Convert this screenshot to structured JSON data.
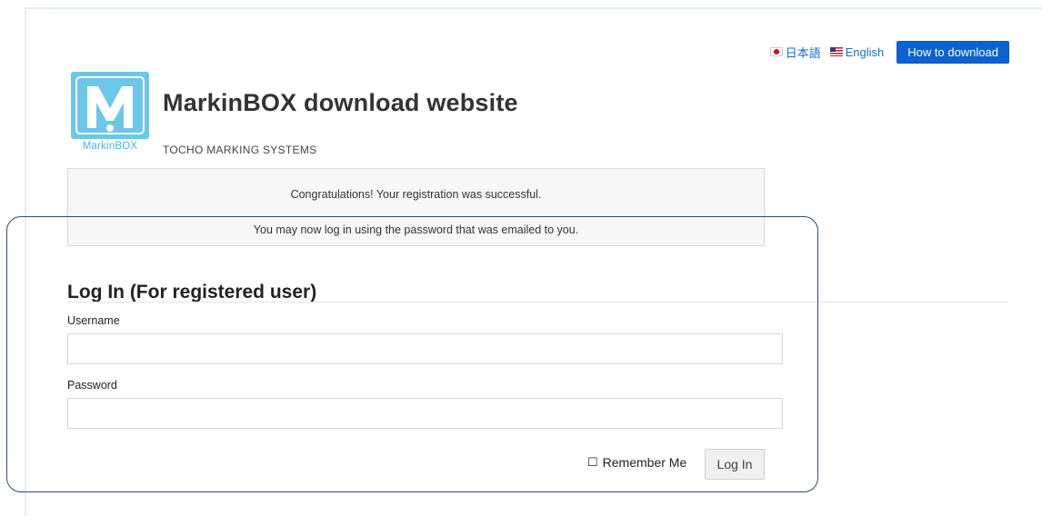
{
  "header": {
    "languages": [
      {
        "label": "日本語",
        "flag_icon": "japan-flag-icon"
      },
      {
        "label": "English",
        "flag_icon": "us-flag-icon"
      }
    ],
    "how_to_download_label": "How to download"
  },
  "brand": {
    "logo_text": "MarkinBOX",
    "title": "MarkinBOX download website",
    "subtitle": "TOCHO MARKING SYSTEMS",
    "logo_color": "#6cc7e6"
  },
  "notice": {
    "line1": "Congratulations! Your registration was successful.",
    "line2": "You may now log in using the password that was emailed to you."
  },
  "login": {
    "title": "Log In (For registered user)",
    "username_label": "Username",
    "username_value": "",
    "password_label": "Password",
    "password_value": "",
    "remember_checkbox": "☐",
    "remember_label": "Remember Me",
    "remember_checked": false,
    "submit_label": "Log In"
  },
  "colors": {
    "primary_button": "#0a63cf",
    "link": "#1a6fc4",
    "highlight_outline": "#2c4a73"
  }
}
